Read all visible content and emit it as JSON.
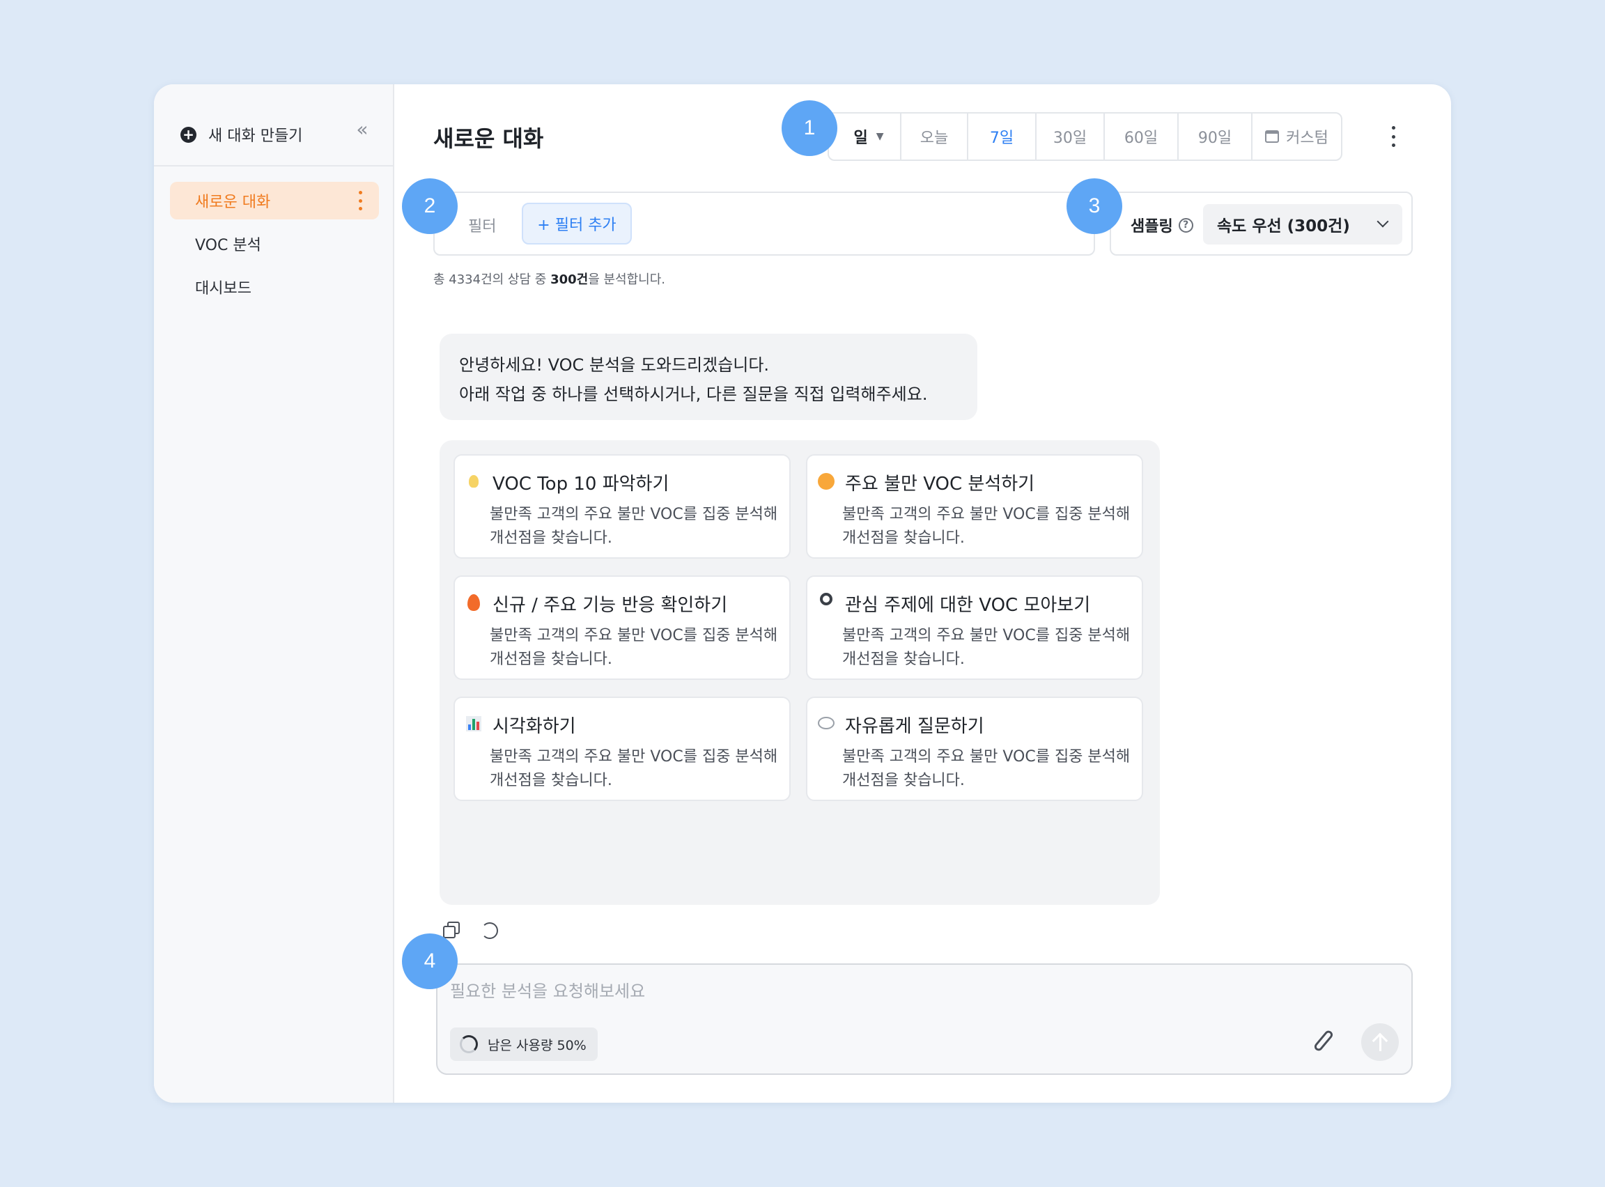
{
  "sidebar": {
    "new_chat_label": "새 대화 만들기",
    "items": [
      {
        "label": "새로운 대화",
        "active": true
      },
      {
        "label": "VOC 분석"
      },
      {
        "label": "대시보드"
      }
    ]
  },
  "header": {
    "title": "새로운 대화",
    "range": {
      "unit": "일",
      "options": [
        "오늘",
        "7일",
        "30일",
        "60일",
        "90일",
        "커스텀"
      ],
      "selected": "7일"
    }
  },
  "filter": {
    "label": "필터",
    "add_label": "+ 필터 추가"
  },
  "sampling": {
    "label": "샘플링",
    "help_icon": "?",
    "selected": "속도 우선 (300건)"
  },
  "summary": {
    "prefix": "총 4334건의 상담 중 ",
    "highlight": "300건",
    "suffix": "을 분석합니다."
  },
  "greeting": {
    "line1": "안녕하세요! VOC 분석을 도와드리겠습니다.",
    "line2": "아래 작업 중 하나를 선택하시거나, 다른 질문을 직접 입력해주세요."
  },
  "cards": [
    {
      "icon": "lightbulb-icon",
      "title": "VOC Top 10 파악하기",
      "desc": "불만족 고객의 주요 불만 VOC를 집중 분석해 개선점을 찾습니다."
    },
    {
      "icon": "angry-face-icon",
      "title": "주요 불만 VOC 분석하기",
      "desc": "불만족 고객의 주요 불만 VOC를 집중 분석해 개선점을 찾습니다."
    },
    {
      "icon": "fire-icon",
      "title": "신규 / 주요 기능 반응 확인하기",
      "desc": "불만족 고객의 주요 불만 VOC를 집중 분석해 개선점을 찾습니다."
    },
    {
      "icon": "magnifier-icon",
      "title": "관심 주제에 대한 VOC 모아보기",
      "desc": "불만족 고객의 주요 불만 VOC를 집중 분석해 개선점을 찾습니다."
    },
    {
      "icon": "bar-chart-icon",
      "title": "시각화하기",
      "desc": "불만족 고객의 주요 불만 VOC를 집중 분석해 개선점을 찾습니다."
    },
    {
      "icon": "speech-bubble-icon",
      "title": "자유롭게 질문하기",
      "desc": "불만족 고객의 주요 불만 VOC를 집중 분석해 개선점을 찾습니다."
    }
  ],
  "input": {
    "placeholder": "필요한 분석을 요청해보세요",
    "value": "",
    "usage_label": "남은 사용량 50%",
    "usage_percent": 50
  },
  "badges": [
    "1",
    "2",
    "3",
    "4"
  ],
  "colors": {
    "accent": "#2d7ff3",
    "active_item_bg": "#fde7d6",
    "active_item_text": "#f07b1f",
    "badge": "#5ea6f5",
    "background": "#dde9f7"
  }
}
